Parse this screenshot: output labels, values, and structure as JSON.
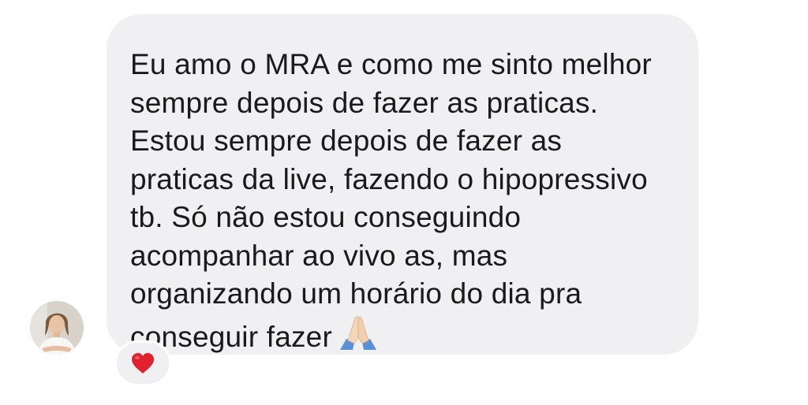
{
  "message": {
    "lines": [
      "Eu amo o MRA e como me sinto melhor",
      "sempre depois de fazer as praticas.",
      "Estou sempre depois de fazer as",
      "praticas da live, fazendo o hipopressivo",
      "tb. Só não estou conseguindo",
      "acompanhar ao vivo as, mas",
      "organizando um horário do dia pra",
      "conseguir fazer"
    ],
    "trailing_emoji": "folded-hands-icon"
  },
  "reaction": {
    "emoji": "red-heart-icon"
  },
  "colors": {
    "bubble_bg": "#f0f0f2",
    "text": "#1a1a1a",
    "heart": "#e0212e"
  }
}
